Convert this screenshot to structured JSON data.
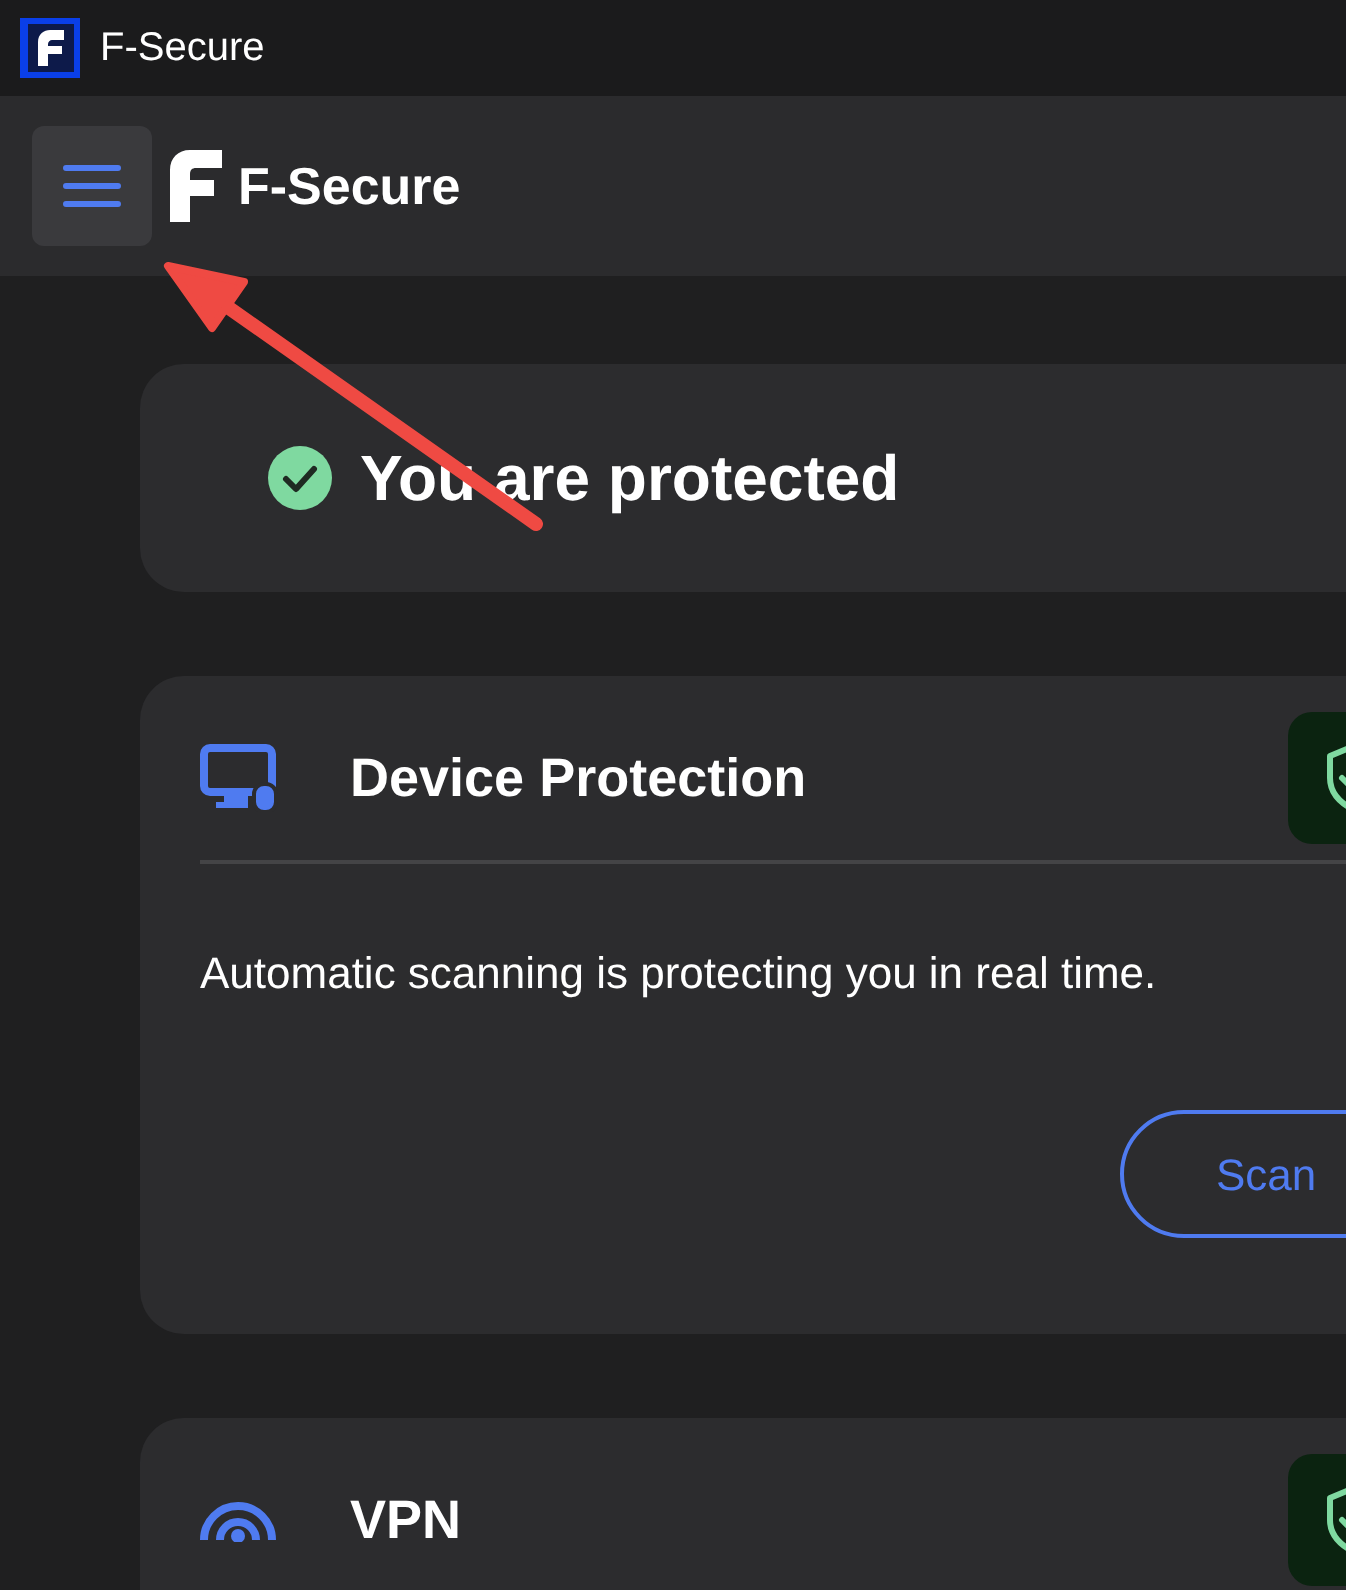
{
  "window": {
    "title": "F-Secure"
  },
  "header": {
    "brand": "F-Secure"
  },
  "status": {
    "text": "You are protected",
    "protected": true
  },
  "cards": [
    {
      "kind": "device",
      "title": "Device Protection",
      "description": "Automatic scanning is protecting you in real time.",
      "button": "Scan",
      "status_ok": true
    },
    {
      "kind": "vpn",
      "title": "VPN",
      "status_ok": true
    }
  ]
}
